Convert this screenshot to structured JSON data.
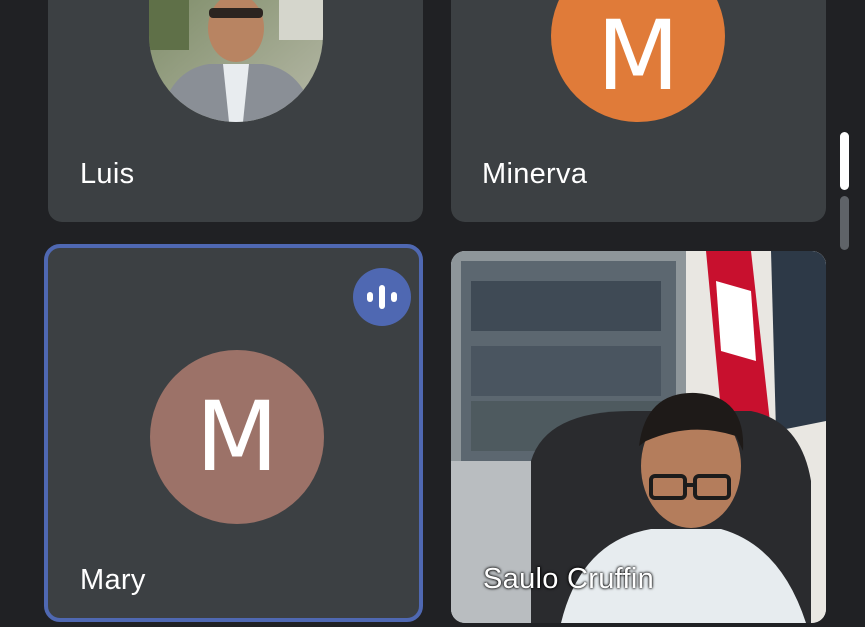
{
  "participants": [
    {
      "name": "Luis",
      "display": "photo",
      "speaking": false
    },
    {
      "name": "Minerva",
      "display": "initial",
      "initial": "M",
      "avatar_color": "#e07b39",
      "speaking": false
    },
    {
      "name": "Mary",
      "display": "initial",
      "initial": "M",
      "avatar_color": "#9c7268",
      "speaking": true
    },
    {
      "name": "Saulo Cruffin",
      "display": "video",
      "speaking": false
    }
  ],
  "colors": {
    "background": "#202124",
    "tile": "#3c4043",
    "active_border": "#4f68b2",
    "speaking_badge": "#4f68b2"
  },
  "icons": {
    "speaking_indicator": "audio-wave-icon"
  }
}
